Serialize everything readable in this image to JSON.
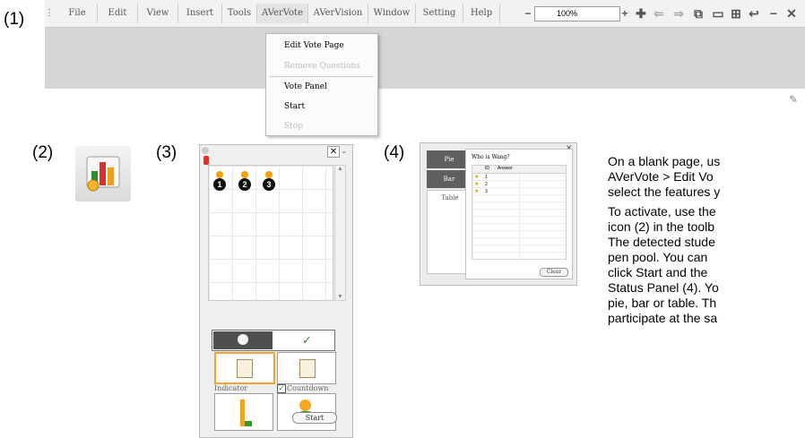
{
  "labels": {
    "n1": "(1)",
    "n2": "(2)",
    "n3": "(3)",
    "n4": "(4)"
  },
  "menubar": {
    "items": [
      "File",
      "Edit",
      "View",
      "Insert",
      "Tools",
      "AVerVote",
      "AVerVision",
      "Window",
      "Setting",
      "Help"
    ],
    "zoom": "100%"
  },
  "dropdown": {
    "items": [
      {
        "label": "Edit Vote Page",
        "enabled": true
      },
      {
        "label": "Remove Questions",
        "enabled": false
      },
      {
        "label": "Vote Panel",
        "enabled": true
      },
      {
        "label": "Start",
        "enabled": true
      },
      {
        "label": "Stop",
        "enabled": false
      }
    ]
  },
  "panel3": {
    "pens": [
      "1",
      "2",
      "3"
    ],
    "indicator_label": "Indicator",
    "countdown_label": "Countdown",
    "countdown_checked": true,
    "start_label": "Start"
  },
  "panel4": {
    "tabs": [
      "Pie",
      "Bar",
      "Table"
    ],
    "question": "Who is Wang?",
    "col_id": "ID",
    "col_answer": "Answer",
    "rows": [
      "1",
      "2",
      "3"
    ],
    "clear_label": "Clear"
  },
  "text": {
    "lines": [
      "On a blank page, us",
      "AVerVote > Edit Vo",
      "select the features y",
      "To activate, use the",
      "icon (2) in the toolb",
      "The detected stude",
      "pen pool. You can",
      "click Start and the",
      "Status Panel (4). Yo",
      "pie, bar or table. Th",
      "participate at the sa"
    ]
  }
}
